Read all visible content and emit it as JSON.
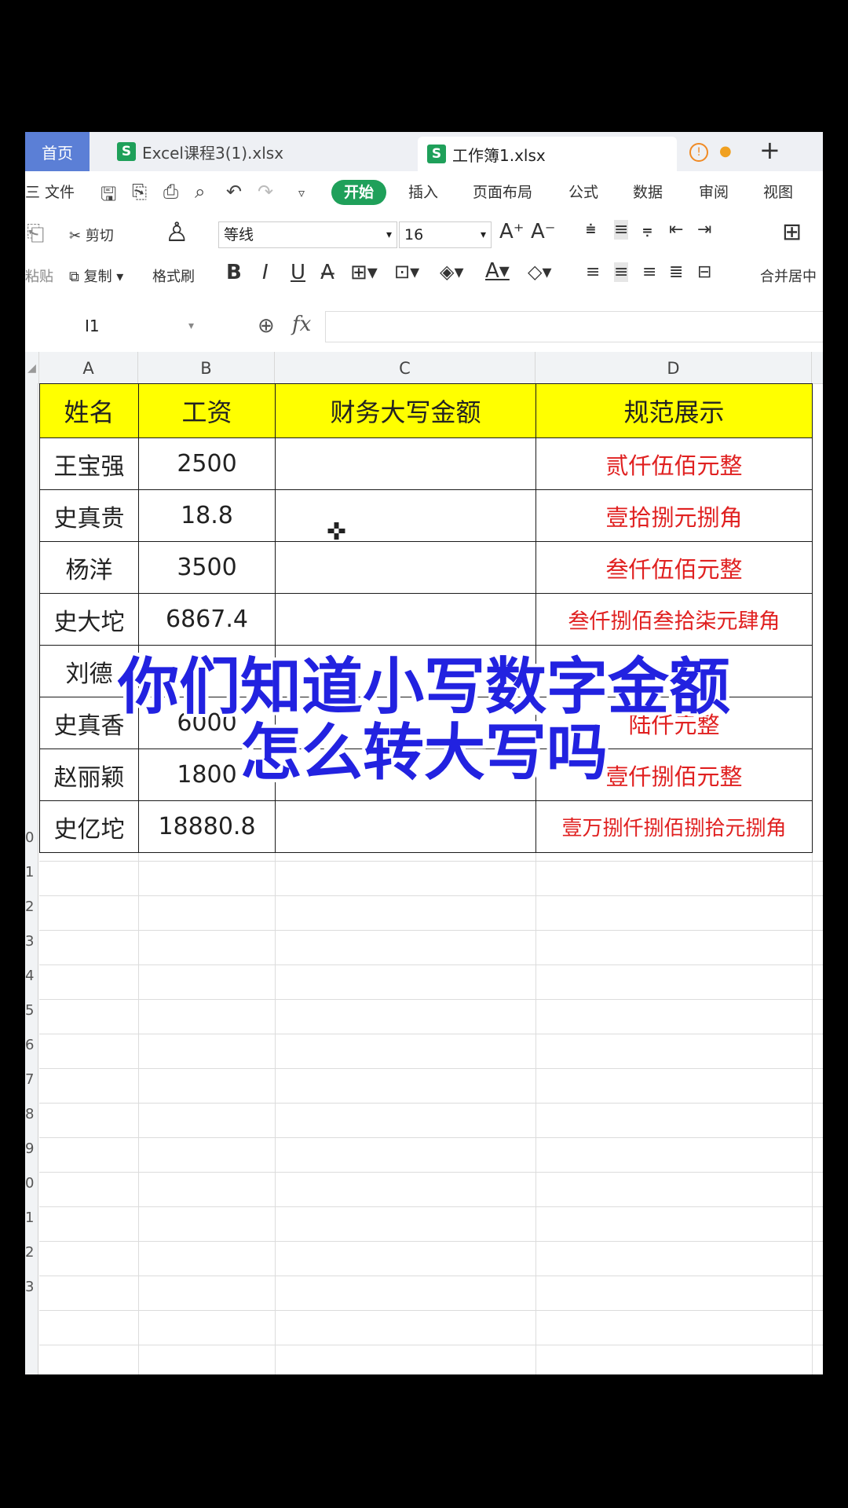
{
  "tabs": {
    "home": "首页",
    "file1": "Excel课程3(1).xlsx",
    "file2": "工作簿1.xlsx",
    "file_icon": "S",
    "plus": "+"
  },
  "menu": {
    "file": "三 文件",
    "start": "开始",
    "insert": "插入",
    "layout": "页面布局",
    "formula": "公式",
    "data": "数据",
    "review": "审阅",
    "view": "视图"
  },
  "ribbon": {
    "paste": "粘贴",
    "cut": "剪切",
    "copy": "复制",
    "format_painter": "格式刷",
    "font_name": "等线",
    "font_size": "16",
    "merge": "合并居中"
  },
  "formula_bar": {
    "cell_ref": "I1",
    "fx": "fx",
    "value": ""
  },
  "columns": [
    "A",
    "B",
    "C",
    "D"
  ],
  "row_numbers_visible": [
    "0",
    "1",
    "2",
    "3",
    "4",
    "5",
    "6",
    "7",
    "8",
    "9",
    "0",
    "1",
    "2",
    "3"
  ],
  "sheet": {
    "headers": [
      "姓名",
      "工资",
      "财务大写金额",
      "规范展示"
    ],
    "rows": [
      [
        "王宝强",
        "2500",
        "",
        "贰仟伍佰元整"
      ],
      [
        "史真贵",
        "18.8",
        "",
        "壹拾捌元捌角"
      ],
      [
        "杨洋",
        "3500",
        "",
        "叁仟伍佰元整"
      ],
      [
        "史大坨",
        "6867.4",
        "",
        "叁仟捌佰叁拾柒元肆角"
      ],
      [
        "刘德",
        "",
        "",
        ""
      ],
      [
        "史真香",
        "6000",
        "",
        "陆仟元整"
      ],
      [
        "赵丽颖",
        "1800",
        "",
        "壹仟捌佰元整"
      ],
      [
        "史亿坨",
        "18880.8",
        "",
        "壹万捌仟捌佰捌拾元捌角"
      ]
    ]
  },
  "caption": {
    "line1": "你们知道小写数字金额",
    "line2": "怎么转大写吗"
  },
  "colors": {
    "header_fill": "#ffff00",
    "amount_red": "#e02020",
    "start_green": "#1fa05a",
    "caption_blue": "#2222e0"
  }
}
